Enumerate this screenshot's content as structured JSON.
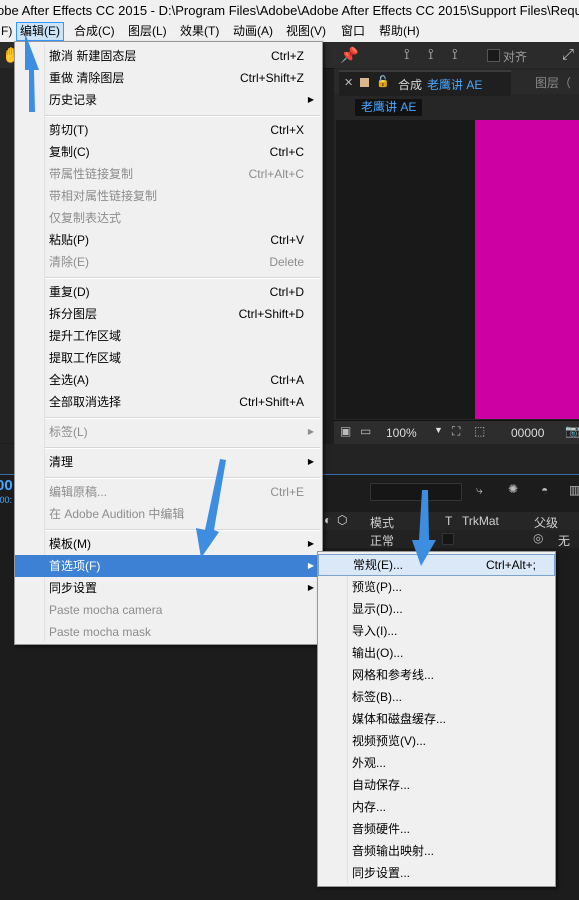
{
  "window": {
    "title": "obe After Effects CC 2015 - D:\\Program Files\\Adobe\\Adobe After Effects CC 2015\\Support Files\\Requ"
  },
  "menubar": [
    {
      "label": "F)"
    },
    {
      "label": "编辑(E)"
    },
    {
      "label": "合成(C)"
    },
    {
      "label": "图层(L)"
    },
    {
      "label": "效果(T)"
    },
    {
      "label": "动画(A)"
    },
    {
      "label": "视图(V)"
    },
    {
      "label": "窗口"
    },
    {
      "label": "帮助(H)"
    }
  ],
  "toolbar": {
    "align_label": "对齐"
  },
  "viewer": {
    "tab_prefix": "合成",
    "tab_name": "老鹰讲 AE",
    "tab_layer": "图层（",
    "comp_chip": "老鹰讲 AE",
    "zoom": "100%",
    "timecode": "00000"
  },
  "timeline": {
    "col_mode": "模式",
    "col_t": "T",
    "col_trkmat": "TrkMat",
    "col_parent": "父级",
    "row_mode": "正常",
    "row_parent": "无",
    "left_stub_time": "00",
    "left_stub_frames": ":00:"
  },
  "edit_menu": {
    "items": [
      {
        "label": "撤消 新建固态层",
        "shortcut": "Ctrl+Z"
      },
      {
        "label": "重做 清除图层",
        "shortcut": "Ctrl+Shift+Z"
      },
      {
        "label": "历史记录",
        "shortcut": ""
      },
      {
        "label": "剪切(T)",
        "shortcut": "Ctrl+X"
      },
      {
        "label": "复制(C)",
        "shortcut": "Ctrl+C"
      },
      {
        "label": "带属性链接复制",
        "shortcut": "Ctrl+Alt+C"
      },
      {
        "label": "带相对属性链接复制",
        "shortcut": ""
      },
      {
        "label": "仅复制表达式",
        "shortcut": ""
      },
      {
        "label": "粘贴(P)",
        "shortcut": "Ctrl+V"
      },
      {
        "label": "清除(E)",
        "shortcut": "Delete"
      },
      {
        "label": "重复(D)",
        "shortcut": "Ctrl+D"
      },
      {
        "label": "拆分图层",
        "shortcut": "Ctrl+Shift+D"
      },
      {
        "label": "提升工作区域",
        "shortcut": ""
      },
      {
        "label": "提取工作区域",
        "shortcut": ""
      },
      {
        "label": "全选(A)",
        "shortcut": "Ctrl+A"
      },
      {
        "label": "全部取消选择",
        "shortcut": "Ctrl+Shift+A"
      },
      {
        "label": "标签(L)",
        "shortcut": ""
      },
      {
        "label": "清理",
        "shortcut": ""
      },
      {
        "label": "编辑原稿...",
        "shortcut": "Ctrl+E"
      },
      {
        "label": "在 Adobe Audition 中编辑",
        "shortcut": ""
      },
      {
        "label": "模板(M)",
        "shortcut": ""
      },
      {
        "label": "首选项(F)",
        "shortcut": ""
      },
      {
        "label": "同步设置",
        "shortcut": ""
      },
      {
        "label": "Paste mocha camera",
        "shortcut": ""
      },
      {
        "label": "Paste mocha mask",
        "shortcut": ""
      }
    ]
  },
  "prefs_menu": {
    "items": [
      {
        "label": "常规(E)...",
        "shortcut": "Ctrl+Alt+;"
      },
      {
        "label": "预览(P)..."
      },
      {
        "label": "显示(D)..."
      },
      {
        "label": "导入(I)..."
      },
      {
        "label": "输出(O)..."
      },
      {
        "label": "网格和参考线..."
      },
      {
        "label": "标签(B)..."
      },
      {
        "label": "媒体和磁盘缓存..."
      },
      {
        "label": "视频预览(V)..."
      },
      {
        "label": "外观..."
      },
      {
        "label": "自动保存..."
      },
      {
        "label": "内存..."
      },
      {
        "label": "音频硬件..."
      },
      {
        "label": "音频输出映射..."
      },
      {
        "label": "同步设置..."
      }
    ]
  },
  "colors": {
    "accent": "#3c81d4",
    "arrow": "#3d8ee0",
    "comp_solid": "#cc00a3"
  }
}
